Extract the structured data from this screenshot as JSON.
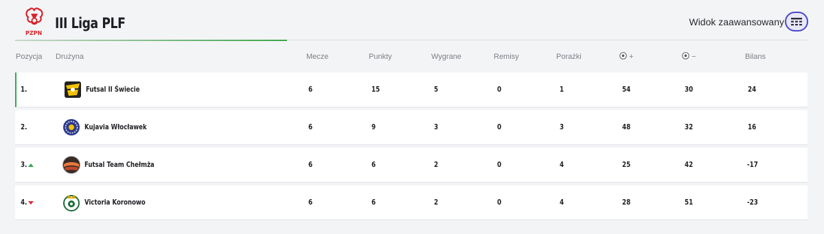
{
  "header": {
    "logo_text": "PZPN",
    "title": "III Liga PLF",
    "advanced_view_label": "Widok zaawansowany",
    "accent_color": "#3aa548",
    "toggle_color": "#4a47c7"
  },
  "columns": {
    "position": "Pozycja",
    "team": "Drużyna",
    "matches": "Mecze",
    "points": "Punkty",
    "wins": "Wygrane",
    "draws": "Remisy",
    "losses": "Porażki",
    "goals_for_icon": "football-icon",
    "goals_for_sign": "+",
    "goals_against_icon": "football-icon",
    "goals_against_sign": "−",
    "balance": "Bilans"
  },
  "rows": [
    {
      "position": "1.",
      "trend": "none",
      "team": "Futsal II Świecie",
      "crest": "swiecie-crest-icon",
      "matches": "6",
      "points": "15",
      "wins": "5",
      "draws": "0",
      "losses": "1",
      "goals_for": "54",
      "goals_against": "30",
      "balance": "24"
    },
    {
      "position": "2.",
      "trend": "none",
      "team": "Kujavia Włocławek",
      "crest": "kujavia-crest-icon",
      "matches": "6",
      "points": "9",
      "wins": "3",
      "draws": "0",
      "losses": "3",
      "goals_for": "48",
      "goals_against": "32",
      "balance": "16"
    },
    {
      "position": "3.",
      "trend": "up",
      "team": "Futsal Team Chełmża",
      "crest": "chelmza-crest-icon",
      "matches": "6",
      "points": "6",
      "wins": "2",
      "draws": "0",
      "losses": "4",
      "goals_for": "25",
      "goals_against": "42",
      "balance": "-17"
    },
    {
      "position": "4.",
      "trend": "down",
      "team": "Victoria Koronowo",
      "crest": "koronowo-crest-icon",
      "matches": "6",
      "points": "6",
      "wins": "2",
      "draws": "0",
      "losses": "4",
      "goals_for": "28",
      "goals_against": "51",
      "balance": "-23"
    }
  ]
}
